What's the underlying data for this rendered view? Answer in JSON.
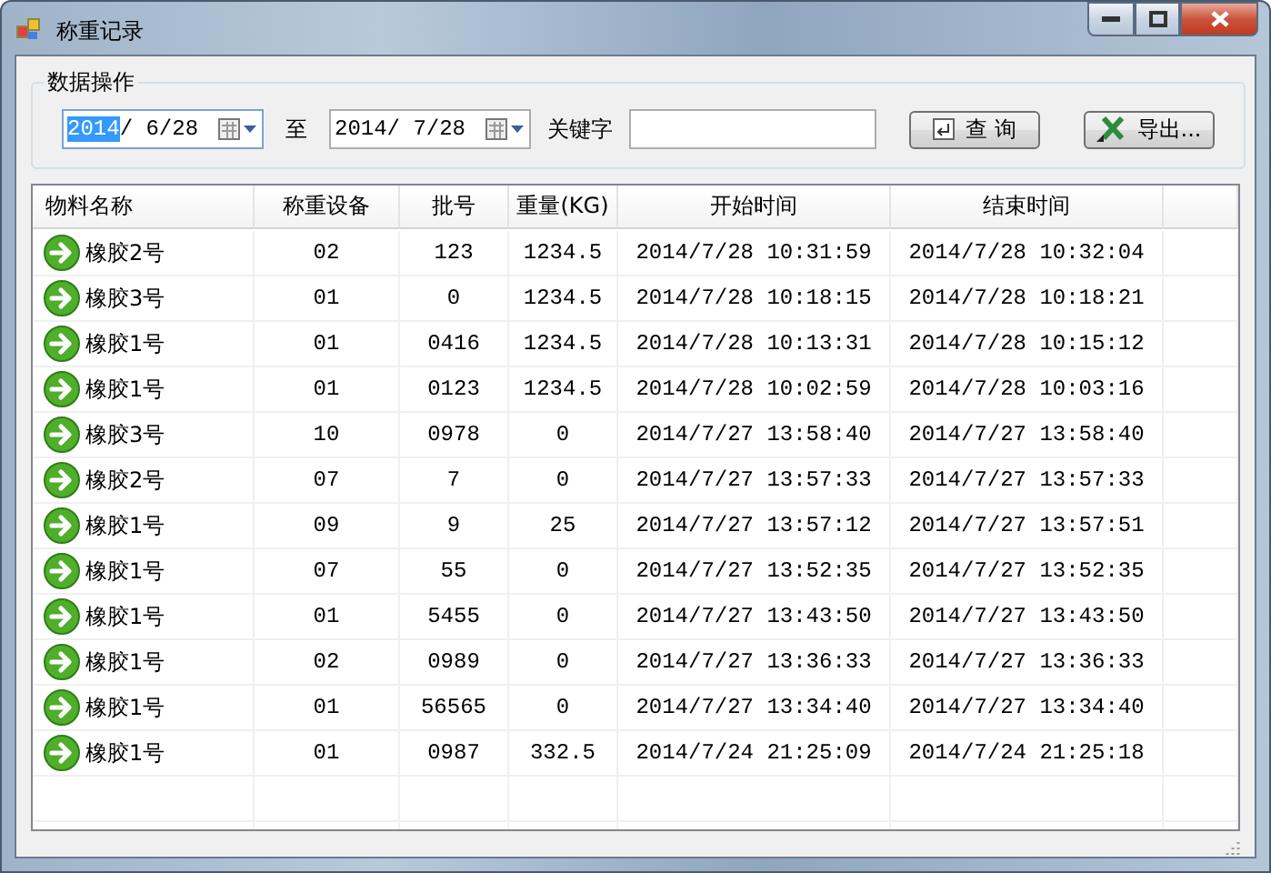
{
  "window": {
    "title": "称重记录"
  },
  "data_ops": {
    "title": "数据操作",
    "date_from": {
      "segments": [
        {
          "text": "2014",
          "selected": true
        },
        {
          "text": "/ 6/28",
          "selected": false
        }
      ]
    },
    "to_label": "至",
    "date_to": {
      "segments": [
        {
          "text": "2014/ 7/28",
          "selected": false
        }
      ]
    },
    "keyword_label": "关键字",
    "query_button": "查 询",
    "export_button": "导出..."
  },
  "table": {
    "columns": [
      "物料名称",
      "称重设备",
      "批号",
      "重量(KG)",
      "开始时间",
      "结束时间"
    ],
    "rows": [
      [
        "橡胶2号",
        "02",
        "123",
        "1234.5",
        "2014/7/28 10:31:59",
        "2014/7/28 10:32:04"
      ],
      [
        "橡胶3号",
        "01",
        "0",
        "1234.5",
        "2014/7/28 10:18:15",
        "2014/7/28 10:18:21"
      ],
      [
        "橡胶1号",
        "01",
        "0416",
        "1234.5",
        "2014/7/28 10:13:31",
        "2014/7/28 10:15:12"
      ],
      [
        "橡胶1号",
        "01",
        "0123",
        "1234.5",
        "2014/7/28 10:02:59",
        "2014/7/28 10:03:16"
      ],
      [
        "橡胶3号",
        "10",
        "0978",
        "0",
        "2014/7/27 13:58:40",
        "2014/7/27 13:58:40"
      ],
      [
        "橡胶2号",
        "07",
        "7",
        "0",
        "2014/7/27 13:57:33",
        "2014/7/27 13:57:33"
      ],
      [
        "橡胶1号",
        "09",
        "9",
        "25",
        "2014/7/27 13:57:12",
        "2014/7/27 13:57:51"
      ],
      [
        "橡胶1号",
        "07",
        "55",
        "0",
        "2014/7/27 13:52:35",
        "2014/7/27 13:52:35"
      ],
      [
        "橡胶1号",
        "01",
        "5455",
        "0",
        "2014/7/27 13:43:50",
        "2014/7/27 13:43:50"
      ],
      [
        "橡胶1号",
        "02",
        "0989",
        "0",
        "2014/7/27 13:36:33",
        "2014/7/27 13:36:33"
      ],
      [
        "橡胶1号",
        "01",
        "56565",
        "0",
        "2014/7/27 13:34:40",
        "2014/7/27 13:34:40"
      ],
      [
        "橡胶1号",
        "01",
        "0987",
        "332.5",
        "2014/7/24 21:25:09",
        "2014/7/24 21:25:18"
      ]
    ]
  }
}
